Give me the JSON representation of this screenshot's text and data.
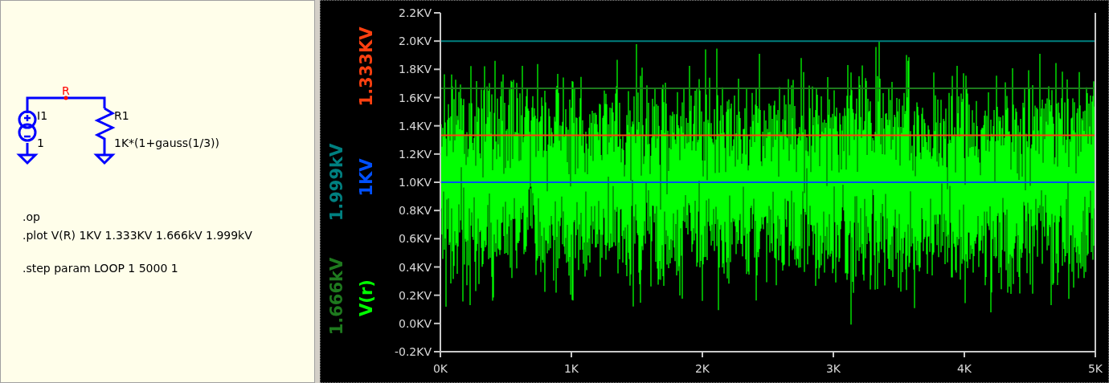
{
  "schematic": {
    "net_label": "R",
    "components": [
      {
        "kind": "current_source",
        "name": "I1",
        "value": "1"
      },
      {
        "kind": "resistor",
        "name": "R1",
        "value": "1K*(1+gauss(1/3))"
      }
    ],
    "directives": [
      ".op",
      ".plot V(R) 1KV 1.333KV 1.666kV 1.999kV",
      ".step param LOOP 1 5000 1"
    ]
  },
  "plot": {
    "trace": {
      "name": "V(r)",
      "color": "#00ff00"
    },
    "chart_data": {
      "type": "line",
      "x": [
        0,
        5
      ],
      "xlim": [
        0,
        5
      ],
      "ylim": [
        -0.2,
        2.2
      ],
      "xticks": [
        {
          "value": 0,
          "label": "0K"
        },
        {
          "value": 1,
          "label": "1K"
        },
        {
          "value": 2,
          "label": "2K"
        },
        {
          "value": 3,
          "label": "3K"
        },
        {
          "value": 4,
          "label": "4K"
        },
        {
          "value": 5,
          "label": "5K"
        }
      ],
      "yticks": [
        {
          "value": 2.2,
          "label": "2.2KV"
        },
        {
          "value": 2.0,
          "label": "2.0KV"
        },
        {
          "value": 1.8,
          "label": "1.8KV"
        },
        {
          "value": 1.6,
          "label": "1.6KV"
        },
        {
          "value": 1.4,
          "label": "1.4KV"
        },
        {
          "value": 1.2,
          "label": "1.2KV"
        },
        {
          "value": 1.0,
          "label": "1.0KV"
        },
        {
          "value": 0.8,
          "label": "0.8KV"
        },
        {
          "value": 0.6,
          "label": "0.6KV"
        },
        {
          "value": 0.4,
          "label": "0.4KV"
        },
        {
          "value": 0.2,
          "label": "0.2KV"
        },
        {
          "value": 0.0,
          "label": "0.0KV"
        },
        {
          "value": -0.2,
          "label": "-0.2KV"
        }
      ],
      "series": [
        {
          "name": "1KV",
          "color": "#0050ff",
          "values": [
            1,
            1
          ]
        },
        {
          "name": "1.333KV",
          "color": "#ff4010",
          "values": [
            1.333,
            1.333
          ]
        },
        {
          "name": "1.666kV",
          "color": "#1e7a1e",
          "values": [
            1.666,
            1.666
          ]
        },
        {
          "name": "1.999kV",
          "color": "#008080",
          "values": [
            1.999,
            1.999
          ]
        }
      ]
    }
  }
}
